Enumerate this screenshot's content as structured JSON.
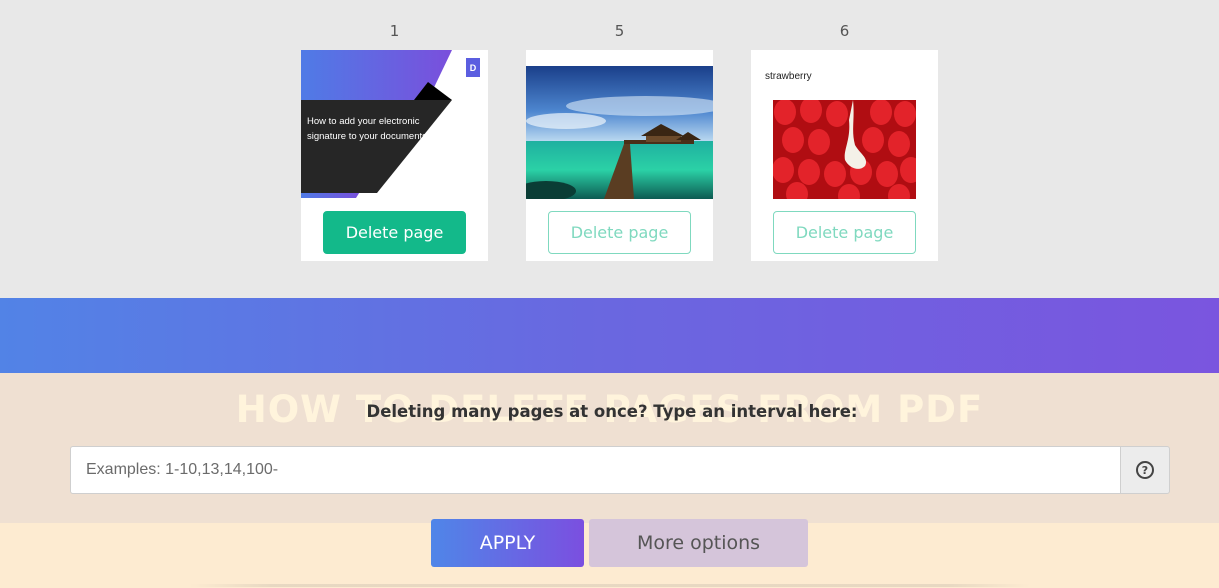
{
  "pages": [
    {
      "number": "1",
      "delete_label": "Delete page",
      "active": true,
      "thumb": {
        "badge": "D",
        "text": "How to add your electronic signature to your documents"
      }
    },
    {
      "number": "5",
      "delete_label": "Delete page",
      "active": false,
      "thumb": {
        "image": "tropical-pier-photo"
      }
    },
    {
      "number": "6",
      "delete_label": "Delete page",
      "active": false,
      "thumb": {
        "label": "strawberry",
        "image": "strawberries-photo"
      }
    }
  ],
  "howto": {
    "heading": "HOW TO DELETE PAGES FROM PDF"
  },
  "interval": {
    "label": "Deleting many pages at once? Type an interval here:",
    "placeholder": "Examples: 1-10,13,14,100-",
    "help_icon": "question-circle-icon"
  },
  "actions": {
    "apply_label": "APPLY",
    "more_label": "More options"
  },
  "colors": {
    "accent_green": "#13b98a",
    "gradient_start": "#5283e6",
    "gradient_end": "#7a55df"
  }
}
